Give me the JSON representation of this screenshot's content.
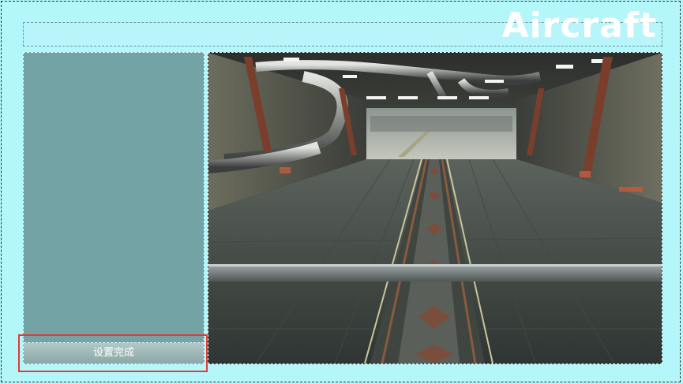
{
  "header": {
    "title": "Aircraft"
  },
  "left_panel": {
    "finish_button_label": "设置完成"
  },
  "viewport": {
    "scene": "hangar-3d-viewport"
  },
  "colors": {
    "background": "#b4f7fb",
    "panel": "#73a3a5",
    "highlight": "#e53935",
    "title_text": "#ffffff"
  }
}
